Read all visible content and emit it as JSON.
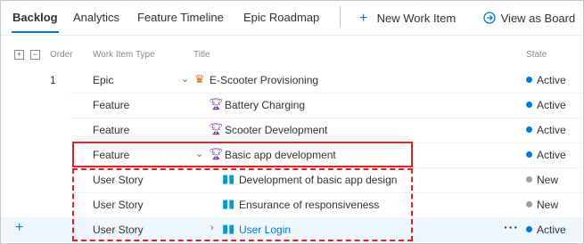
{
  "tabs": [
    {
      "label": "Backlog",
      "active": true
    },
    {
      "label": "Analytics"
    },
    {
      "label": "Feature Timeline"
    },
    {
      "label": "Epic Roadmap"
    }
  ],
  "toolbar": {
    "new_work_item": {
      "label": "New Work Item",
      "icon": "plus-icon"
    },
    "view_as_board": {
      "label": "View as Board",
      "icon": "arrow-circle-right-icon"
    }
  },
  "grid_header": {
    "expand_all": "+",
    "collapse_all": "−",
    "order": "Order",
    "type": "Work Item Type",
    "title": "Title",
    "state": "State"
  },
  "rows": [
    {
      "order": "1",
      "type": "Epic",
      "title": "E-Scooter Provisioning",
      "state": "Active",
      "icon": "crown-icon",
      "chevron": "⌄"
    },
    {
      "order": "",
      "type": "Feature",
      "title": "Battery Charging",
      "state": "Active",
      "icon": "trophy-icon"
    },
    {
      "order": "",
      "type": "Feature",
      "title": "Scooter Development",
      "state": "Active",
      "icon": "trophy-icon"
    },
    {
      "order": "",
      "type": "Feature",
      "title": "Basic app development",
      "state": "Active",
      "icon": "trophy-icon",
      "chevron": "⌄"
    },
    {
      "order": "",
      "type": "User Story",
      "title": "Development of basic app design",
      "state": "New",
      "icon": "book-icon"
    },
    {
      "order": "",
      "type": "User Story",
      "title": "Ensurance of responsiveness",
      "state": "New",
      "icon": "book-icon"
    },
    {
      "order": "",
      "type": "User Story",
      "title": "User Login",
      "state": "Active",
      "icon": "book-icon",
      "chevron": "›",
      "more": "···",
      "add": "+"
    }
  ],
  "colors": {
    "accent": "#0078d4",
    "active_state": "#0078d4",
    "new_state": "#a19f9d",
    "epic": "#e06d00",
    "feature": "#773b93",
    "story": "#009ccc",
    "highlight": "#e32028"
  }
}
